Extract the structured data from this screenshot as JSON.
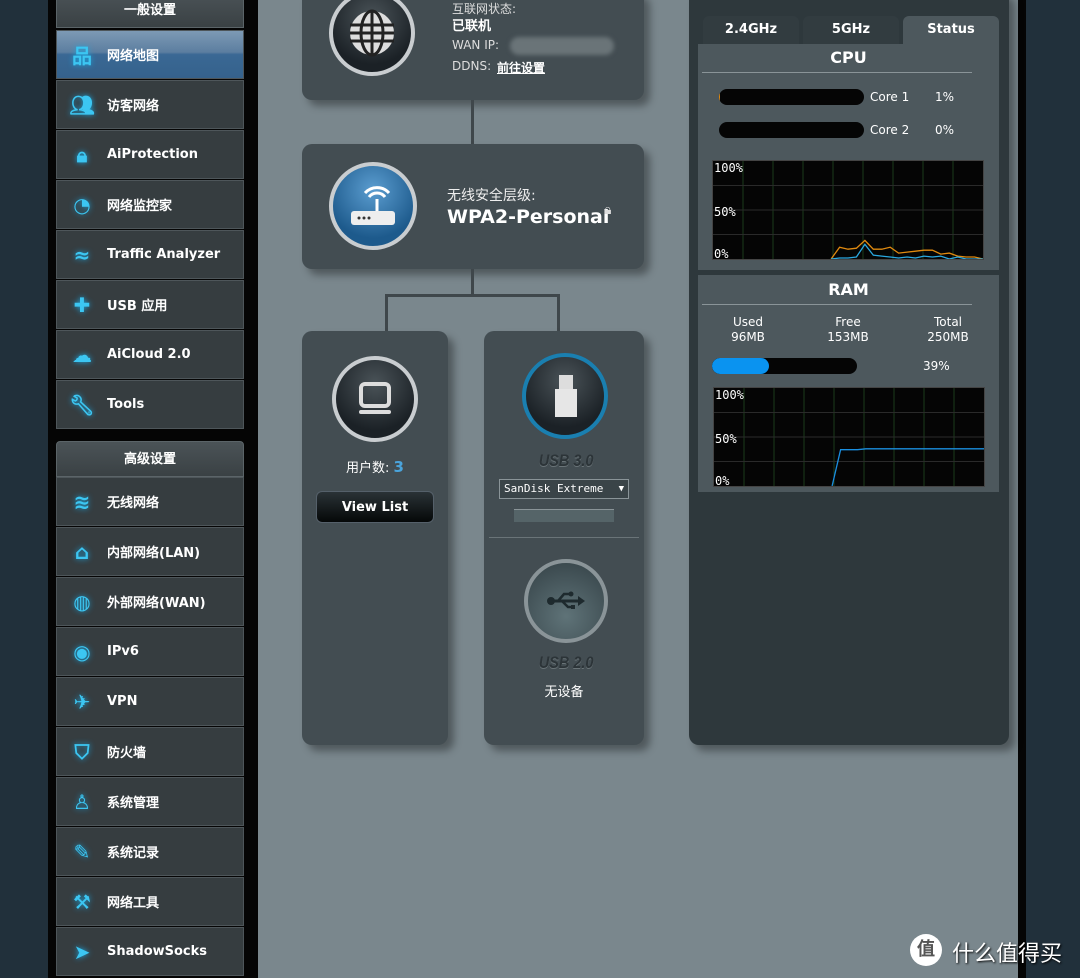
{
  "sidebar": {
    "general_title": "一般设置",
    "general_items": [
      {
        "label": "网络地图",
        "icon": "network-map-icon",
        "active": true
      },
      {
        "label": "访客网络",
        "icon": "guest-network-icon"
      },
      {
        "label": "AiProtection",
        "icon": "lock-icon"
      },
      {
        "label": "网络监控家",
        "icon": "speedometer-icon"
      },
      {
        "label": "Traffic Analyzer",
        "icon": "traffic-chart-icon"
      },
      {
        "label": "USB 应用",
        "icon": "puzzle-icon"
      },
      {
        "label": "AiCloud 2.0",
        "icon": "cloud-icon"
      },
      {
        "label": "Tools",
        "icon": "wrench-icon"
      }
    ],
    "advanced_title": "高级设置",
    "advanced_items": [
      {
        "label": "无线网络",
        "icon": "wifi-icon"
      },
      {
        "label": "内部网络(LAN)",
        "icon": "home-icon"
      },
      {
        "label": "外部网络(WAN)",
        "icon": "globe-icon"
      },
      {
        "label": "IPv6",
        "icon": "ipv6-icon"
      },
      {
        "label": "VPN",
        "icon": "vpn-icon"
      },
      {
        "label": "防火墙",
        "icon": "shield-icon"
      },
      {
        "label": "系统管理",
        "icon": "admin-user-icon"
      },
      {
        "label": "系统记录",
        "icon": "log-icon"
      },
      {
        "label": "网络工具",
        "icon": "network-tools-icon"
      },
      {
        "label": "ShadowSocks",
        "icon": "paper-plane-icon"
      }
    ]
  },
  "internet": {
    "status_label": "互联网状态:",
    "status_value": "已联机",
    "wan_ip_label": "WAN IP:",
    "ddns_label": "DDNS:",
    "ddns_link": "前往设置"
  },
  "wireless": {
    "security_label": "无线安全层级:",
    "security_value": "WPA2-Personal"
  },
  "clients": {
    "label": "用户数:",
    "count": "3",
    "view_list": "View List"
  },
  "usb": {
    "usb3_label": "USB 3.0",
    "device_selected": "SanDisk Extreme",
    "usb2_label": "USB 2.0",
    "usb2_status": "无设备"
  },
  "status_panel": {
    "tabs": [
      "2.4GHz",
      "5GHz",
      "Status"
    ],
    "active_tab": "Status",
    "cpu_title": "CPU",
    "cores": [
      {
        "label": "Core 1",
        "value": "1%",
        "percent": 1
      },
      {
        "label": "Core 2",
        "value": "0%",
        "percent": 0
      }
    ],
    "ram_title": "RAM",
    "used_label": "Used",
    "used": "96MB",
    "free_label": "Free",
    "free": "153MB",
    "total_label": "Total",
    "total": "250MB",
    "ram_percent_text": "39%",
    "ram_percent": 39,
    "colors": {
      "core1": "#e08a10",
      "core2": "#2aa8e0",
      "ram": "#1a8fe0"
    }
  },
  "chart_data": [
    {
      "type": "line",
      "title": "CPU",
      "ylim": [
        0,
        100
      ],
      "yticks": [
        "100%",
        "50%",
        "0%"
      ],
      "series": [
        {
          "name": "Core 1",
          "values": [
            null,
            null,
            null,
            null,
            null,
            null,
            null,
            null,
            null,
            null,
            null,
            null,
            null,
            null,
            0,
            12,
            10,
            11,
            19,
            10,
            10,
            12,
            6,
            7,
            8,
            9,
            9,
            5,
            6,
            3,
            2,
            2,
            0
          ]
        },
        {
          "name": "Core 2",
          "values": [
            null,
            null,
            null,
            null,
            null,
            null,
            null,
            null,
            null,
            null,
            null,
            null,
            null,
            null,
            0,
            1,
            1,
            2,
            15,
            4,
            3,
            2,
            1,
            2,
            1,
            3,
            2,
            3,
            0,
            2,
            0,
            0,
            0
          ]
        }
      ]
    },
    {
      "type": "line",
      "title": "RAM",
      "ylim": [
        0,
        100
      ],
      "yticks": [
        "100%",
        "50%",
        "0%"
      ],
      "series": [
        {
          "values": [
            null,
            null,
            null,
            null,
            null,
            null,
            null,
            null,
            null,
            null,
            null,
            null,
            null,
            null,
            0,
            37,
            37,
            37,
            38,
            38,
            38,
            38,
            38,
            38,
            38,
            38,
            38,
            38,
            38,
            38,
            38,
            38,
            38
          ]
        }
      ]
    }
  ],
  "watermark": {
    "text": "什么值得买",
    "logo_char": "值"
  }
}
